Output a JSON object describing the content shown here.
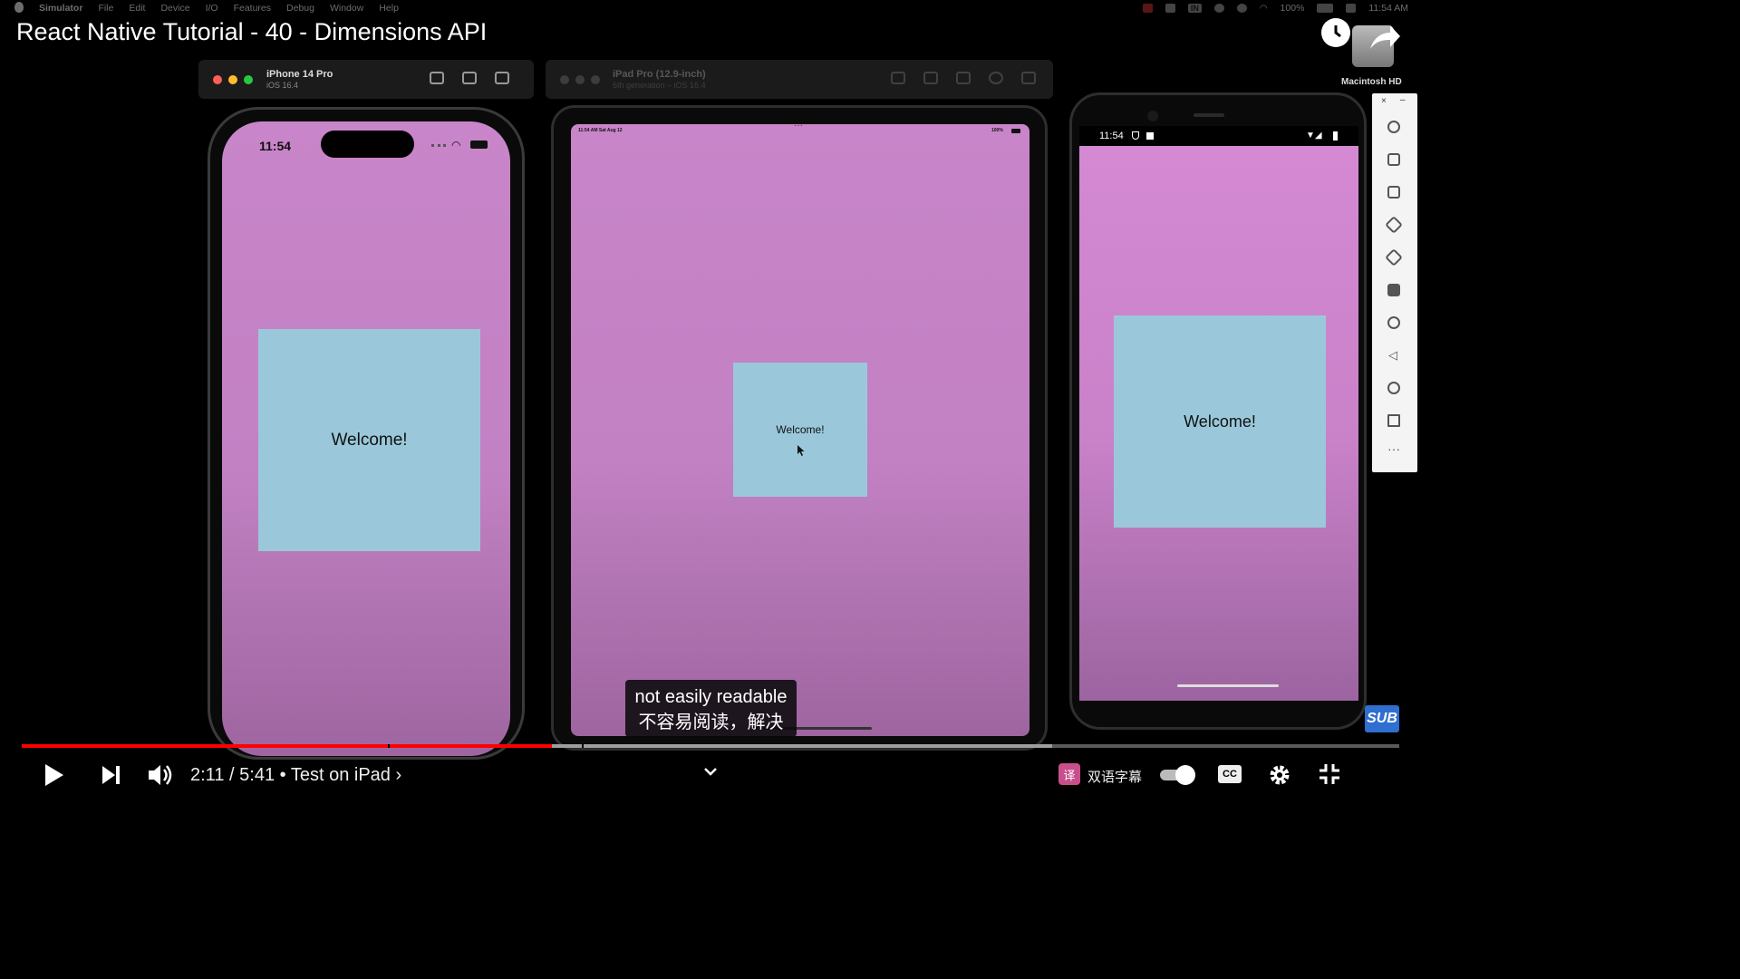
{
  "menubar": {
    "app": "Simulator",
    "items": [
      "File",
      "Edit",
      "Device",
      "I/O",
      "Features",
      "Debug",
      "Window",
      "Help"
    ],
    "battery": "100%",
    "clock": "11:54 AM",
    "input_badge": "IN"
  },
  "video": {
    "title": "React Native Tutorial - 40 - Dimensions API"
  },
  "simulators": {
    "iphone": {
      "name": "iPhone 14 Pro",
      "os": "iOS 16.4"
    },
    "ipad": {
      "name": "iPad Pro (12.9-inch)",
      "os": "6th generation – iOS 16.4"
    }
  },
  "devices": {
    "iphone": {
      "time": "11:54",
      "welcome": "Welcome!"
    },
    "ipad": {
      "time": "11:54 AM  Sat Aug 12",
      "battery": "100%",
      "welcome": "Welcome!"
    },
    "android": {
      "time": "11:54",
      "welcome": "Welcome!"
    }
  },
  "desktop": {
    "disk_label": "Macintosh HD"
  },
  "captions": {
    "line_en": "not easily readable",
    "line_zh": "不容易阅读，解决"
  },
  "badge": {
    "sub_logo": "SUB"
  },
  "player": {
    "current_time": "2:11",
    "separator": "/",
    "duration": "5:41",
    "chapter": "• Test on iPad ›",
    "progress": 0.385,
    "buffered": 0.748,
    "bilingual_label": "双语字幕",
    "bilingual_icon": "译",
    "cc_label": "CC"
  },
  "colors": {
    "app_background": "#c885c9",
    "box_background": "#9ac8da",
    "progress_played": "#ff0000"
  },
  "icons": [
    "apple-icon",
    "clock-icon",
    "share-icon",
    "home-icon",
    "screenshot-icon",
    "rotate-icon",
    "brightness-icon",
    "power-icon",
    "volume-up-icon",
    "volume-down-icon",
    "rotate-left-icon",
    "rotate-right-icon",
    "camera-icon",
    "zoom-icon",
    "back-icon",
    "home-circle-icon",
    "overview-icon",
    "more-icon",
    "play-icon",
    "next-icon",
    "volume-icon",
    "chevron-down-icon",
    "settings-icon",
    "exit-fullscreen-icon"
  ]
}
